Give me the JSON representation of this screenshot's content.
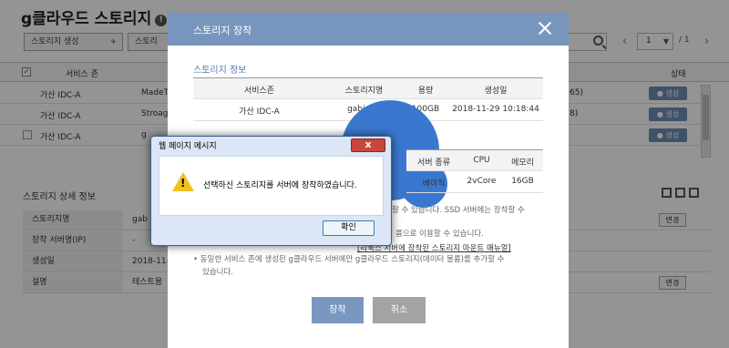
{
  "background": {
    "page_title": "g클라우드 스토리지",
    "create_button": "스토리지 생성",
    "create_plus": "+",
    "storage_button": "스토리",
    "pager": {
      "current": "1",
      "total": "/ 1",
      "prev": "‹",
      "next": "›"
    },
    "table_header": {
      "zone": "서비스 존",
      "status": "상태"
    },
    "rows": [
      {
        "zone": "가산 IDC-A",
        "name": "MadeTe",
        "tail": "65)",
        "status": "● 생성",
        "checked": false
      },
      {
        "zone": "가산 IDC-A",
        "name": "Stroage",
        "tail": "8)",
        "status": "● 생성",
        "checked": false
      },
      {
        "zone": "가산 IDC-A",
        "name": "g",
        "tail": "",
        "status": "● 생성",
        "checked": false
      }
    ],
    "detail_title": "스토리지 상세 정보",
    "detail_rows": [
      {
        "key": "스토리지명",
        "value": "gab",
        "button": "변경"
      },
      {
        "key": "장착 서버명(IP)",
        "value": "-",
        "button": ""
      },
      {
        "key": "생성일",
        "value": "2018-11-",
        "button": ""
      },
      {
        "key": "설명",
        "value": "테스트용",
        "button": "변경"
      }
    ]
  },
  "modal": {
    "title": "스토리지 장착",
    "section_title": "스토리지 정보",
    "info_table": {
      "headers": [
        "서비스존",
        "스토리지명",
        "용량",
        "생성일"
      ],
      "row": [
        "가산 IDC-A",
        "gabiastr",
        "100GB",
        "2018-11-29 10:18:44"
      ]
    },
    "server_table": {
      "headers": [
        "서버 종류",
        "CPU",
        "메모리"
      ],
      "row": [
        "베이직",
        "2vCore",
        "16GB"
      ]
    },
    "notes": {
      "line1": "할 수 있습니다. SSD 서버에는 장착할 수",
      "line2": "륨으로 이용할 수 있습니다.",
      "link": "[리눅스 서버에 장착된 스토리지 마운트 매뉴얼]",
      "line3": "• 동일한 서비스 존에 생성된 g클라우드 서버에만 g클라우드 스토리지(데이터 볼륨)를 추가할 수",
      "line4": "있습니다."
    },
    "mount_button": "장착",
    "cancel_button": "취소"
  },
  "alert": {
    "title": "웹 페이지 메시지",
    "message": "선택하신 스토리지를 서버에 장착하였습니다.",
    "ok_button": "확인",
    "close_glyph": "x"
  }
}
